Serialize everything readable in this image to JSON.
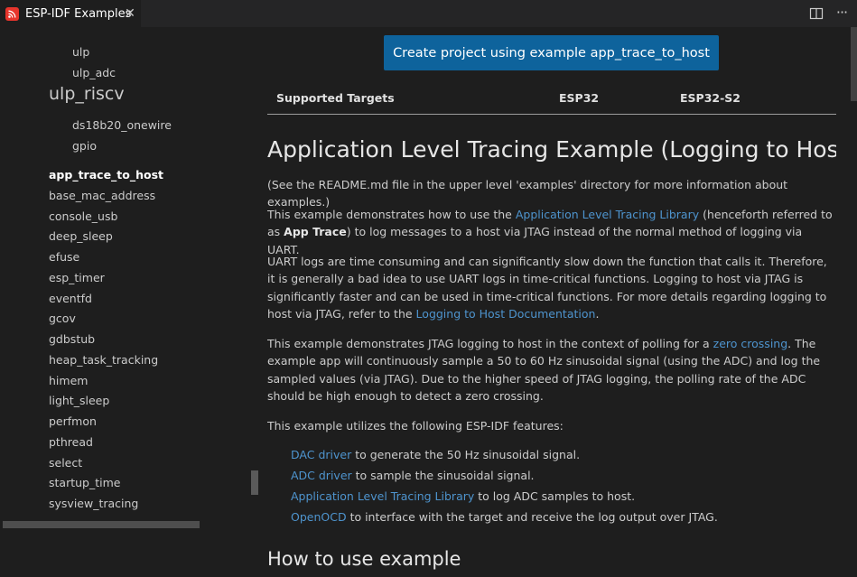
{
  "tab": {
    "title": "ESP-IDF Examples",
    "close": "✕",
    "icon": "esp-idf-logo"
  },
  "toolbar": {
    "split_icon": "split-editor-icon",
    "more": "···"
  },
  "sidebar": {
    "items_top": [
      {
        "label": "ulp",
        "level": "sub"
      },
      {
        "label": "ulp_adc",
        "level": "sub"
      }
    ],
    "heading": "ulp_riscv",
    "items_riscv": [
      {
        "label": "ds18b20_onewire"
      },
      {
        "label": "gpio"
      }
    ],
    "items": [
      {
        "label": "app_trace_to_host",
        "selected": true
      },
      {
        "label": "base_mac_address"
      },
      {
        "label": "console_usb"
      },
      {
        "label": "deep_sleep"
      },
      {
        "label": "efuse"
      },
      {
        "label": "esp_timer"
      },
      {
        "label": "eventfd"
      },
      {
        "label": "gcov"
      },
      {
        "label": "gdbstub"
      },
      {
        "label": "heap_task_tracking"
      },
      {
        "label": "himem"
      },
      {
        "label": "light_sleep"
      },
      {
        "label": "perfmon"
      },
      {
        "label": "pthread"
      },
      {
        "label": "select"
      },
      {
        "label": "startup_time"
      },
      {
        "label": "sysview_tracing"
      }
    ]
  },
  "content": {
    "create_button": "Create project using example app_trace_to_host",
    "targets": {
      "label": "Supported Targets",
      "t1": "ESP32",
      "t2": "ESP32-S2"
    },
    "title": "Application Level Tracing Example (Logging to Host)",
    "p1": "(See the README.md file in the upper level 'examples' directory for more information about examples.)",
    "p2": {
      "a": "This example demonstrates how to use the ",
      "link": "Application Level Tracing Library",
      "b": " (henceforth referred to as ",
      "strong": "App Trace",
      "c": ") to log messages to a host via JTAG instead of the normal method of logging via UART."
    },
    "p3": {
      "a": "UART logs are time consuming and can significantly slow down the function that calls it. Therefore, it is generally a bad idea to use UART logs in time-critical functions. Logging to host via JTAG is significantly faster and can be used in time-critical functions. For more details regarding logging to host via JTAG, refer to the ",
      "link": "Logging to Host Documentation",
      "b": "."
    },
    "p4": {
      "a": "This example demonstrates JTAG logging to host in the context of polling for a ",
      "link": "zero crossing",
      "b": ". The example app will continuously sample a 50 to 60 Hz sinusoidal signal (using the ADC) and log the sampled values (via JTAG). Due to the higher speed of JTAG logging, the polling rate of the ADC should be high enough to detect a zero crossing."
    },
    "p5": "This example utilizes the following ESP-IDF features:",
    "features": [
      {
        "link": "DAC driver",
        "text": " to generate the 50 Hz sinusoidal signal."
      },
      {
        "link": "ADC driver",
        "text": " to sample the sinusoidal signal."
      },
      {
        "link": "Application Level Tracing Library",
        "text": " to log ADC samples to host."
      },
      {
        "link": "OpenOCD",
        "text": " to interface with the target and receive the log output over JTAG."
      }
    ],
    "h2": "How to use example"
  },
  "colors": {
    "accent": "#0e639c",
    "link": "#4e94ce",
    "background": "#1e1e1e"
  }
}
